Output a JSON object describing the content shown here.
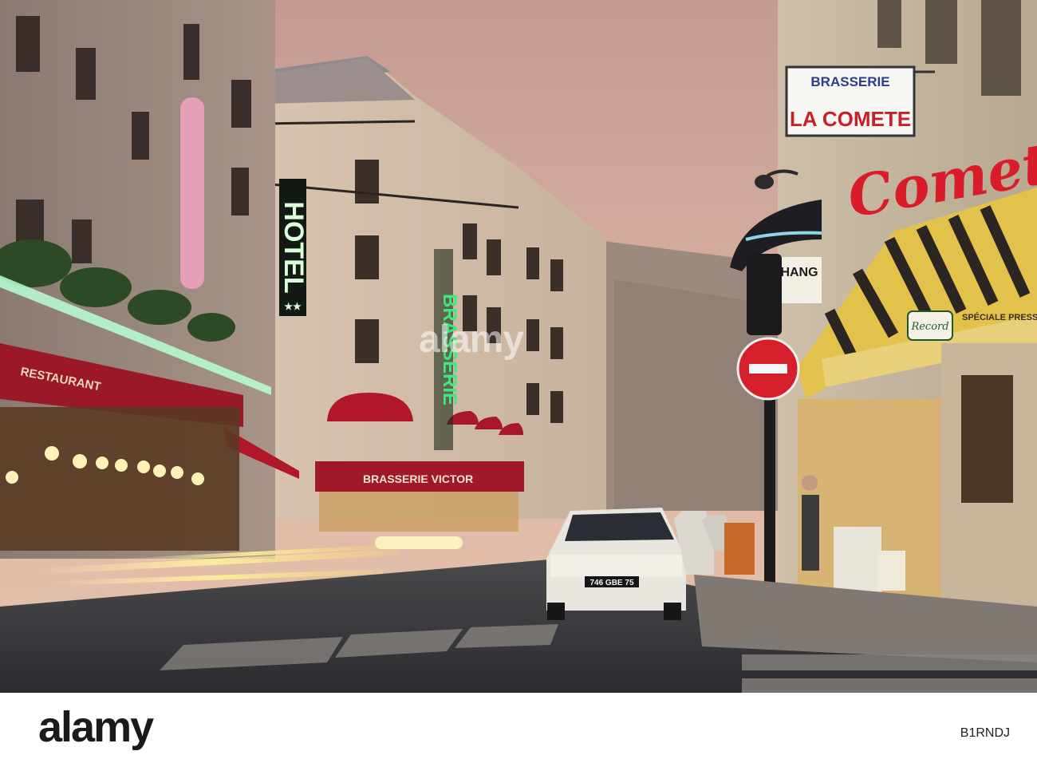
{
  "photo": {
    "signs": {
      "hotel": "HOTEL",
      "hotel_stars": "★★",
      "brasserie_vertical": "BRASSERIE",
      "brasserie_victor": "BRASSERIE VICTOR",
      "la_comete_top": "BRASSERIE",
      "la_comete_bottom": "LA COMETE",
      "comete_neon": "Comet",
      "restaurant_awning": "RESTAURANT",
      "change_sign": "HANG",
      "speciale_pression": "SPÉCIALE PRESSION",
      "record_badge": "Record",
      "plate": "746 GBE 75"
    }
  },
  "overlay": {
    "watermark": "alamy"
  },
  "footer": {
    "brand": "alamy",
    "image_id": "B1RNDJ"
  },
  "colors": {
    "sky": "#d9b4a4",
    "neon_green": "#3fe87a",
    "awning_red": "#b0182a",
    "sign_red": "#c8202b"
  }
}
